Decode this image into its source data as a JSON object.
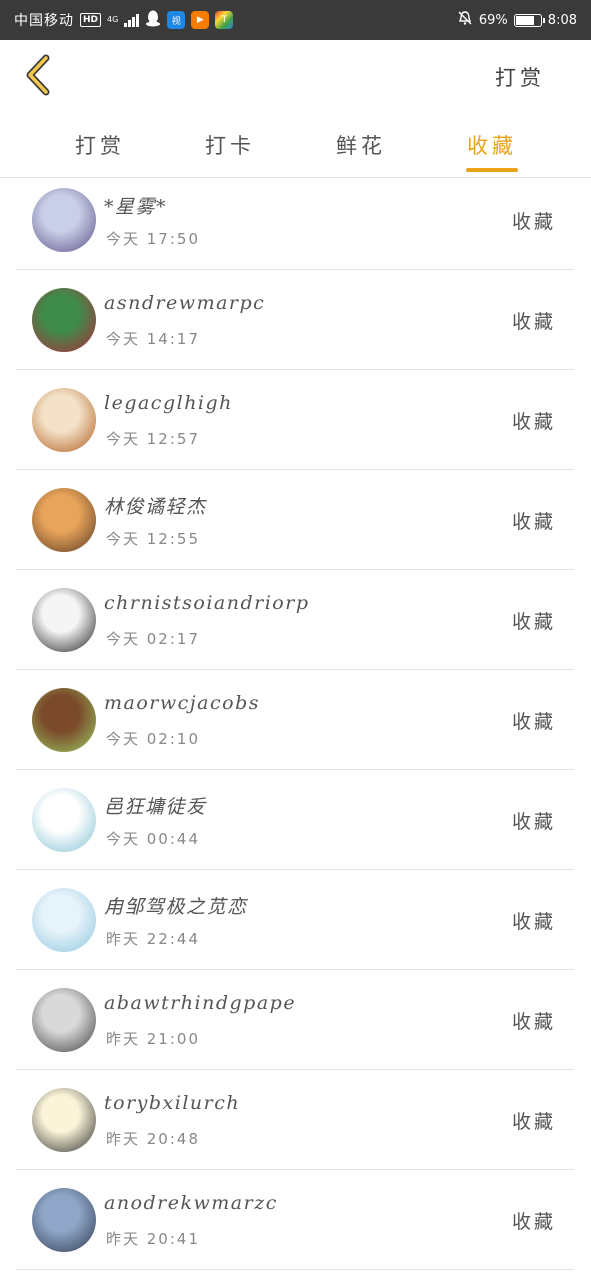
{
  "status_bar": {
    "carrier": "中国移动",
    "hd": "HD",
    "network": "4G",
    "battery_pct_text": "69%",
    "time": "8:08",
    "app_icons": [
      {
        "name": "qq-icon",
        "glyph": "",
        "color": "#3a3a3a"
      },
      {
        "name": "app-blue-icon",
        "glyph": "视",
        "color": "#1e88e5"
      },
      {
        "name": "app-orange-icon",
        "glyph": "▶",
        "color": "#f57c00"
      },
      {
        "name": "app-multicolor-icon",
        "glyph": "T",
        "color": "#7b1fa2"
      }
    ]
  },
  "header": {
    "back_icon": "chevron-left-icon",
    "action_label": "打赏"
  },
  "tabs": [
    {
      "label": "打赏",
      "active": false
    },
    {
      "label": "打卡",
      "active": false
    },
    {
      "label": "鲜花",
      "active": false
    },
    {
      "label": "收藏",
      "active": true
    }
  ],
  "accent_color": "#e8a317",
  "list": [
    {
      "name": "*星雾*",
      "time": "今天 17:50",
      "action": "收藏",
      "avatar_colors": [
        "#c9cfe6",
        "#5a4f8a"
      ]
    },
    {
      "name": "asndrewmarpc",
      "time": "今天 14:17",
      "action": "收藏",
      "avatar_colors": [
        "#3f8b4a",
        "#b02a3b"
      ]
    },
    {
      "name": "legacglhigh",
      "time": "今天 12:57",
      "action": "收藏",
      "avatar_colors": [
        "#f3e2c7",
        "#b05a1e"
      ]
    },
    {
      "name": "林俊谲轻杰",
      "time": "今天 12:55",
      "action": "收藏",
      "avatar_colors": [
        "#e8a45a",
        "#5a3b25"
      ]
    },
    {
      "name": "chrnistsoiandriorp",
      "time": "今天 02:17",
      "action": "收藏",
      "avatar_colors": [
        "#f5f5f5",
        "#1e1e1e"
      ]
    },
    {
      "name": "maorwcjacobs",
      "time": "今天 02:10",
      "action": "收藏",
      "avatar_colors": [
        "#7a4a2a",
        "#9ccc65"
      ]
    },
    {
      "name": "邑狂墉徒叐",
      "time": "今天 00:44",
      "action": "收藏",
      "avatar_colors": [
        "#ffffff",
        "#7fbfd0"
      ]
    },
    {
      "name": "甪邹驾极之苋恋",
      "time": "昨天 22:44",
      "action": "收藏",
      "avatar_colors": [
        "#e6f3fa",
        "#8ec5de"
      ]
    },
    {
      "name": "abawtrhindgpape",
      "time": "昨天 21:00",
      "action": "收藏",
      "avatar_colors": [
        "#d9d9d9",
        "#3d3d3d"
      ]
    },
    {
      "name": "torybxilurch",
      "time": "昨天 20:48",
      "action": "收藏",
      "avatar_colors": [
        "#fbf4d8",
        "#2b2b2b"
      ]
    },
    {
      "name": "anodrekwmarzc",
      "time": "昨天 20:41",
      "action": "收藏",
      "avatar_colors": [
        "#8fa6c8",
        "#2e3a4e"
      ]
    }
  ]
}
